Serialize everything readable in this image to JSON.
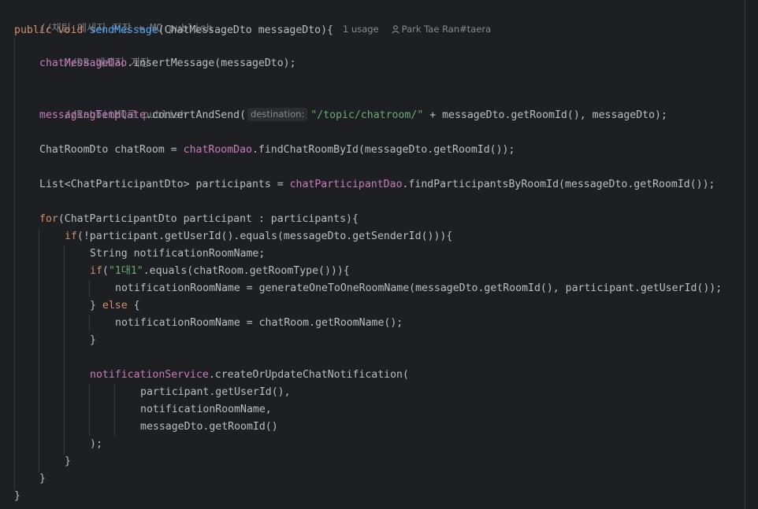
{
  "colors": {
    "background": "#1e1f22",
    "text": "#bcbec4",
    "comment": "#7a7e85",
    "keyword": "#cf8e6d",
    "method_declaration": "#56a8f5",
    "field": "#c77dbb",
    "string": "#6aab73",
    "inlay_hint": "#868a91",
    "indent_guide": "#393b40"
  },
  "usage_hint": "1 usage",
  "author_hint": "Park Tae Ran#taera",
  "author_icon": "person-icon",
  "param_hint": "destination:",
  "code": {
    "l1": "//채팅 메세지 저장 + MQ publish",
    "l2_kw1": "public",
    "l2_kw2": "void",
    "l2_fn": "sendMessage",
    "l2_rest": "(ChatMessageDto messageDto){",
    "l3": "//DB 메세지 저장",
    "l4_field": "chatMessageDao",
    "l4_rest": ".insertMessage(messageDto);",
    "l6": "//RabbitMQ로 publish",
    "l7_field": "messagingTemplate",
    "l7_mid": ".convertAndSend(",
    "l7_str": "\"/topic/chatroom/\"",
    "l7_rest": " + messageDto.getRoomId(), messageDto);",
    "l9_a": "ChatRoomDto chatRoom = ",
    "l9_field": "chatRoomDao",
    "l9_rest": ".findChatRoomById(messageDto.getRoomId());",
    "l11_a": "List<ChatParticipantDto> participants = ",
    "l11_field": "chatParticipantDao",
    "l11_rest": ".findParticipantsByRoomId(messageDto.getRoomId());",
    "l13_kw": "for",
    "l13_rest": "(ChatParticipantDto participant : participants){",
    "l14_kw": "if",
    "l14_rest": "(!participant.getUserId().equals(messageDto.getSenderId())){",
    "l15": "String notificationRoomName;",
    "l16_kw": "if",
    "l16_a": "(",
    "l16_str": "\"1대1\"",
    "l16_rest": ".equals(chatRoom.getRoomType())){",
    "l17": "notificationRoomName = generateOneToOneRoomName(messageDto.getRoomId(), participant.getUserId());",
    "l18_a": "} ",
    "l18_kw": "else",
    "l18_rest": " {",
    "l19": "notificationRoomName = chatRoom.getRoomName();",
    "l20": "}",
    "l22_field": "notificationService",
    "l22_rest": ".createOrUpdateChatNotification(",
    "l23": "participant.getUserId(),",
    "l24": "notificationRoomName,",
    "l25": "messageDto.getRoomId()",
    "l26": ");",
    "l27": "}",
    "l28": "}",
    "l29": "}"
  }
}
